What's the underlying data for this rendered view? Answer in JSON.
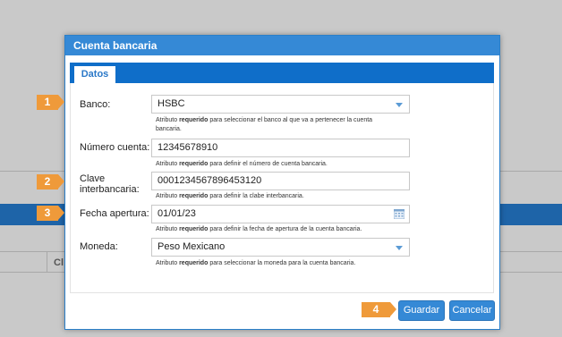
{
  "background": {
    "cell_text": "Cl"
  },
  "dialog": {
    "title": "Cuenta bancaria",
    "tab_label": "Datos",
    "fields": {
      "banco": {
        "label": "Banco:",
        "value": "HSBC",
        "hint_prefix": "Atributo ",
        "hint_bold": "requerido",
        "hint_suffix": " para seleccionar el banco al que va a pertenecer la cuenta bancaria."
      },
      "numero_cuenta": {
        "label": "Número cuenta:",
        "value": "12345678910",
        "hint_prefix": "Atributo ",
        "hint_bold": "requerido",
        "hint_suffix": " para definir el número de cuenta bancaria."
      },
      "clabe": {
        "label_line1": "Clave",
        "label_line2": "interbancaria:",
        "value": "0001234567896453120",
        "hint_prefix": "Atributo ",
        "hint_bold": "requerido",
        "hint_suffix": " para definir la clabe interbancaria."
      },
      "fecha_apertura": {
        "label": "Fecha apertura:",
        "value": "01/01/23",
        "hint_prefix": "Atributo ",
        "hint_bold": "requerido",
        "hint_suffix": " para definir la fecha de apertura de la cuenta bancaria."
      },
      "moneda": {
        "label": "Moneda:",
        "value": "Peso Mexicano",
        "hint_prefix": "Atributo ",
        "hint_bold": "requerido",
        "hint_suffix": " para seleccionar la moneda para la cuenta bancaria."
      }
    },
    "buttons": {
      "save": "Guardar",
      "cancel": "Cancelar"
    }
  },
  "steps": [
    "1",
    "2",
    "3",
    "4"
  ],
  "colors": {
    "header": "#3589d6",
    "tabbar": "#0f6ec9",
    "step_badge": "#ef9a3a",
    "button": "#3589d6"
  },
  "icons": {
    "select_arrow": "chevron-down-icon",
    "calendar": "calendar-icon"
  }
}
